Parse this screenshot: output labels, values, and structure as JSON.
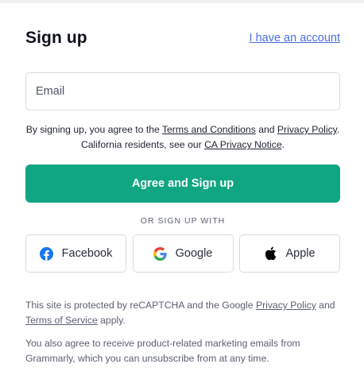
{
  "header": {
    "title": "Sign up",
    "login_link": "I have an account"
  },
  "email": {
    "placeholder": "Email",
    "value": ""
  },
  "legal": {
    "prefix": "By signing up, you agree to the ",
    "terms_link": "Terms and Conditions",
    "and": " and ",
    "privacy_link": "Privacy Policy",
    "middle": ". California residents, see our ",
    "ca_link": "CA Privacy Notice",
    "suffix": "."
  },
  "primary_button": {
    "label": "Agree and Sign up",
    "color": "#11a683"
  },
  "divider": "OR SIGN UP WITH",
  "social": [
    {
      "label": "Facebook",
      "icon": "facebook-icon"
    },
    {
      "label": "Google",
      "icon": "google-icon"
    },
    {
      "label": "Apple",
      "icon": "apple-icon"
    }
  ],
  "recaptcha": {
    "prefix": "This site is protected by reCAPTCHA and the Google ",
    "privacy_link": "Privacy Policy",
    "and": " and ",
    "terms_link": "Terms of Service",
    "suffix": " apply."
  },
  "marketing": "You also agree to receive product-related marketing emails from Grammarly, which you can unsubscribe from at any time."
}
